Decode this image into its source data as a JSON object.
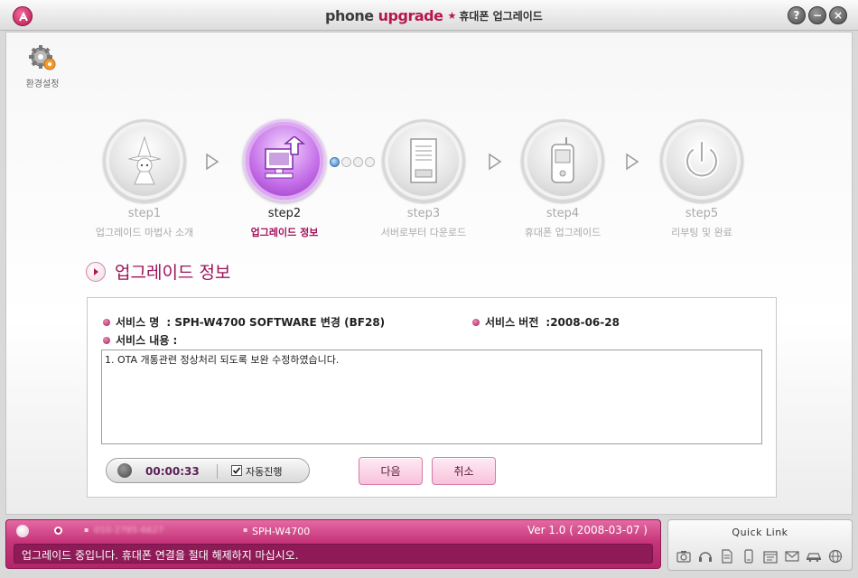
{
  "window": {
    "brand_plain": "phone ",
    "brand_accent": "upgrade",
    "subtitle": "휴대폰 업그레이드",
    "star": "★",
    "help": "?",
    "minimize": "−",
    "close": "×"
  },
  "toolbar": {
    "settings_label": "환경설정"
  },
  "steps": [
    {
      "num": "step1",
      "name": "업그레이드 마법사 소개",
      "icon": "wizard-icon"
    },
    {
      "num": "step2",
      "name": "업그레이드 정보",
      "icon": "computer-upload-icon",
      "active": true
    },
    {
      "num": "step3",
      "name": "서버로부터 다운로드",
      "icon": "server-icon"
    },
    {
      "num": "step4",
      "name": "휴대폰 업그레이드",
      "icon": "phone-icon"
    },
    {
      "num": "step5",
      "name": "리부팅 및 완료",
      "icon": "power-icon"
    }
  ],
  "section": {
    "title": "업그레이드 정보"
  },
  "info": {
    "service_name_label": "서비스 명",
    "service_name_value": ": SPH-W4700 SOFTWARE 변경 (BF28)",
    "version_label": "서비스 버전",
    "version_value": ":2008-06-28",
    "content_label": "서비스 내용 :",
    "content_text": "1. OTA 개통관련 정상처리 되도록 보완 수정하였습니다."
  },
  "controls": {
    "timer": "00:00:33",
    "auto_label": "자동진행",
    "auto_checked": true,
    "next_label": "다음",
    "cancel_label": "취소"
  },
  "status": {
    "phone_number_blurred": "010-2785-6627",
    "model": "SPH-W4700",
    "version": "Ver 1.0 ( 2008-03-07 )",
    "message": "업그레이드 중입니다. 휴대폰 연결을 절대 해제하지 마십시오."
  },
  "quick_link": {
    "title": "Quick Link",
    "icons": [
      "camera-icon",
      "headset-icon",
      "document-icon",
      "phone-icon",
      "calendar-icon",
      "mail-icon",
      "car-icon",
      "globe-icon"
    ]
  },
  "colors": {
    "accent": "#b8154f",
    "status_bg": "#c6357a",
    "active_step": "#c46ee8"
  }
}
